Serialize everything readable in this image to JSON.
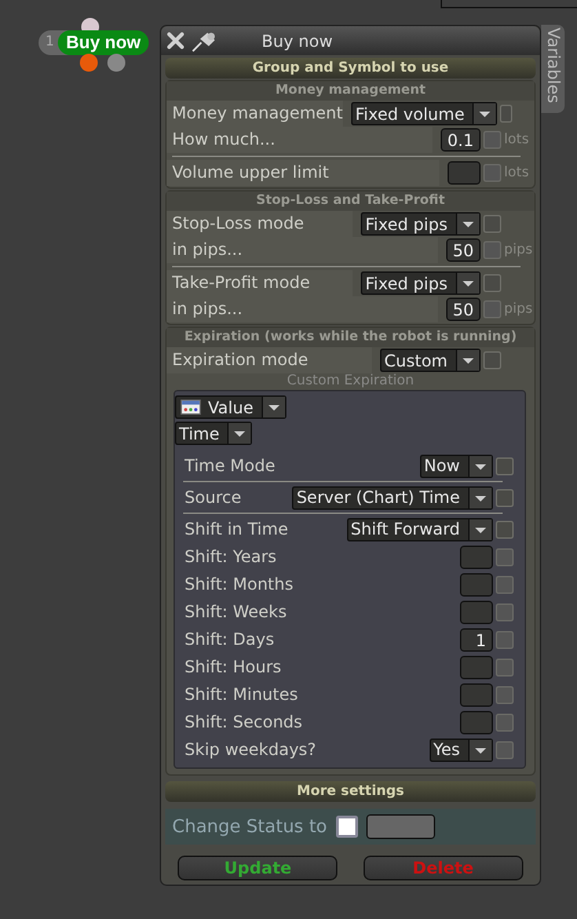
{
  "node": {
    "number": "1",
    "label": "Buy now"
  },
  "window": {
    "title": "Buy now",
    "side_tab": "Variables"
  },
  "sections": [
    {
      "kind": "bar",
      "title": "Group and Symbol to use"
    },
    {
      "kind": "group",
      "title": "Money management",
      "rows": [
        {
          "kind": "select",
          "label": "Money management",
          "value": "Fixed volume",
          "checked": false
        },
        {
          "kind": "number",
          "label": "How much...",
          "value": "0.1",
          "unit": "lots",
          "checked": false
        },
        {
          "kind": "divider"
        },
        {
          "kind": "number",
          "label": "Volume upper limit",
          "unit": "lots",
          "checked": false
        }
      ]
    },
    {
      "kind": "group",
      "title": "Stop-Loss and Take-Profit",
      "rows": [
        {
          "kind": "select",
          "label": "Stop-Loss mode",
          "value": "Fixed pips",
          "checked": false
        },
        {
          "kind": "number",
          "label": "in pips...",
          "value": "50",
          "unit": "pips",
          "checked": false
        },
        {
          "kind": "divider"
        },
        {
          "kind": "select",
          "label": "Take-Profit mode",
          "value": "Fixed pips",
          "checked": false
        },
        {
          "kind": "number",
          "label": "in pips...",
          "value": "50",
          "unit": "pips",
          "checked": false
        }
      ]
    },
    {
      "kind": "group",
      "title": "Expiration (works while the robot is running)",
      "rows": [
        {
          "kind": "select",
          "label": "Expiration mode",
          "value": "Custom",
          "checked": false
        }
      ],
      "subpanel": {
        "title": "Custom Expiration",
        "value_select": "Value",
        "type_select": "Time",
        "rows": [
          {
            "kind": "select",
            "label": "Time Mode",
            "value": "Now",
            "checked": false
          },
          {
            "kind": "divider"
          },
          {
            "kind": "select",
            "label": "Source",
            "value": "Server (Chart) Time",
            "checked": false
          },
          {
            "kind": "divider"
          },
          {
            "kind": "select",
            "label": "Shift in Time",
            "value": "Shift Forward",
            "checked": false
          },
          {
            "kind": "number",
            "label": "Shift: Years",
            "checked": false
          },
          {
            "kind": "number",
            "label": "Shift: Months",
            "checked": false
          },
          {
            "kind": "number",
            "label": "Shift: Weeks",
            "checked": false
          },
          {
            "kind": "number",
            "label": "Shift: Days",
            "value": "1",
            "checked": false
          },
          {
            "kind": "number",
            "label": "Shift: Hours",
            "checked": false
          },
          {
            "kind": "number",
            "label": "Shift: Minutes",
            "checked": false
          },
          {
            "kind": "number",
            "label": "Shift: Seconds",
            "checked": false
          },
          {
            "kind": "select",
            "label": "Skip weekdays?",
            "value": "Yes",
            "checked": false
          }
        ]
      }
    },
    {
      "kind": "bar",
      "title": "More settings"
    }
  ],
  "status": {
    "label": "Change Status to",
    "checked": false
  },
  "buttons": [
    {
      "label": "Update",
      "color": "#33aa33"
    },
    {
      "label": "Delete",
      "color": "#cc1111"
    }
  ]
}
